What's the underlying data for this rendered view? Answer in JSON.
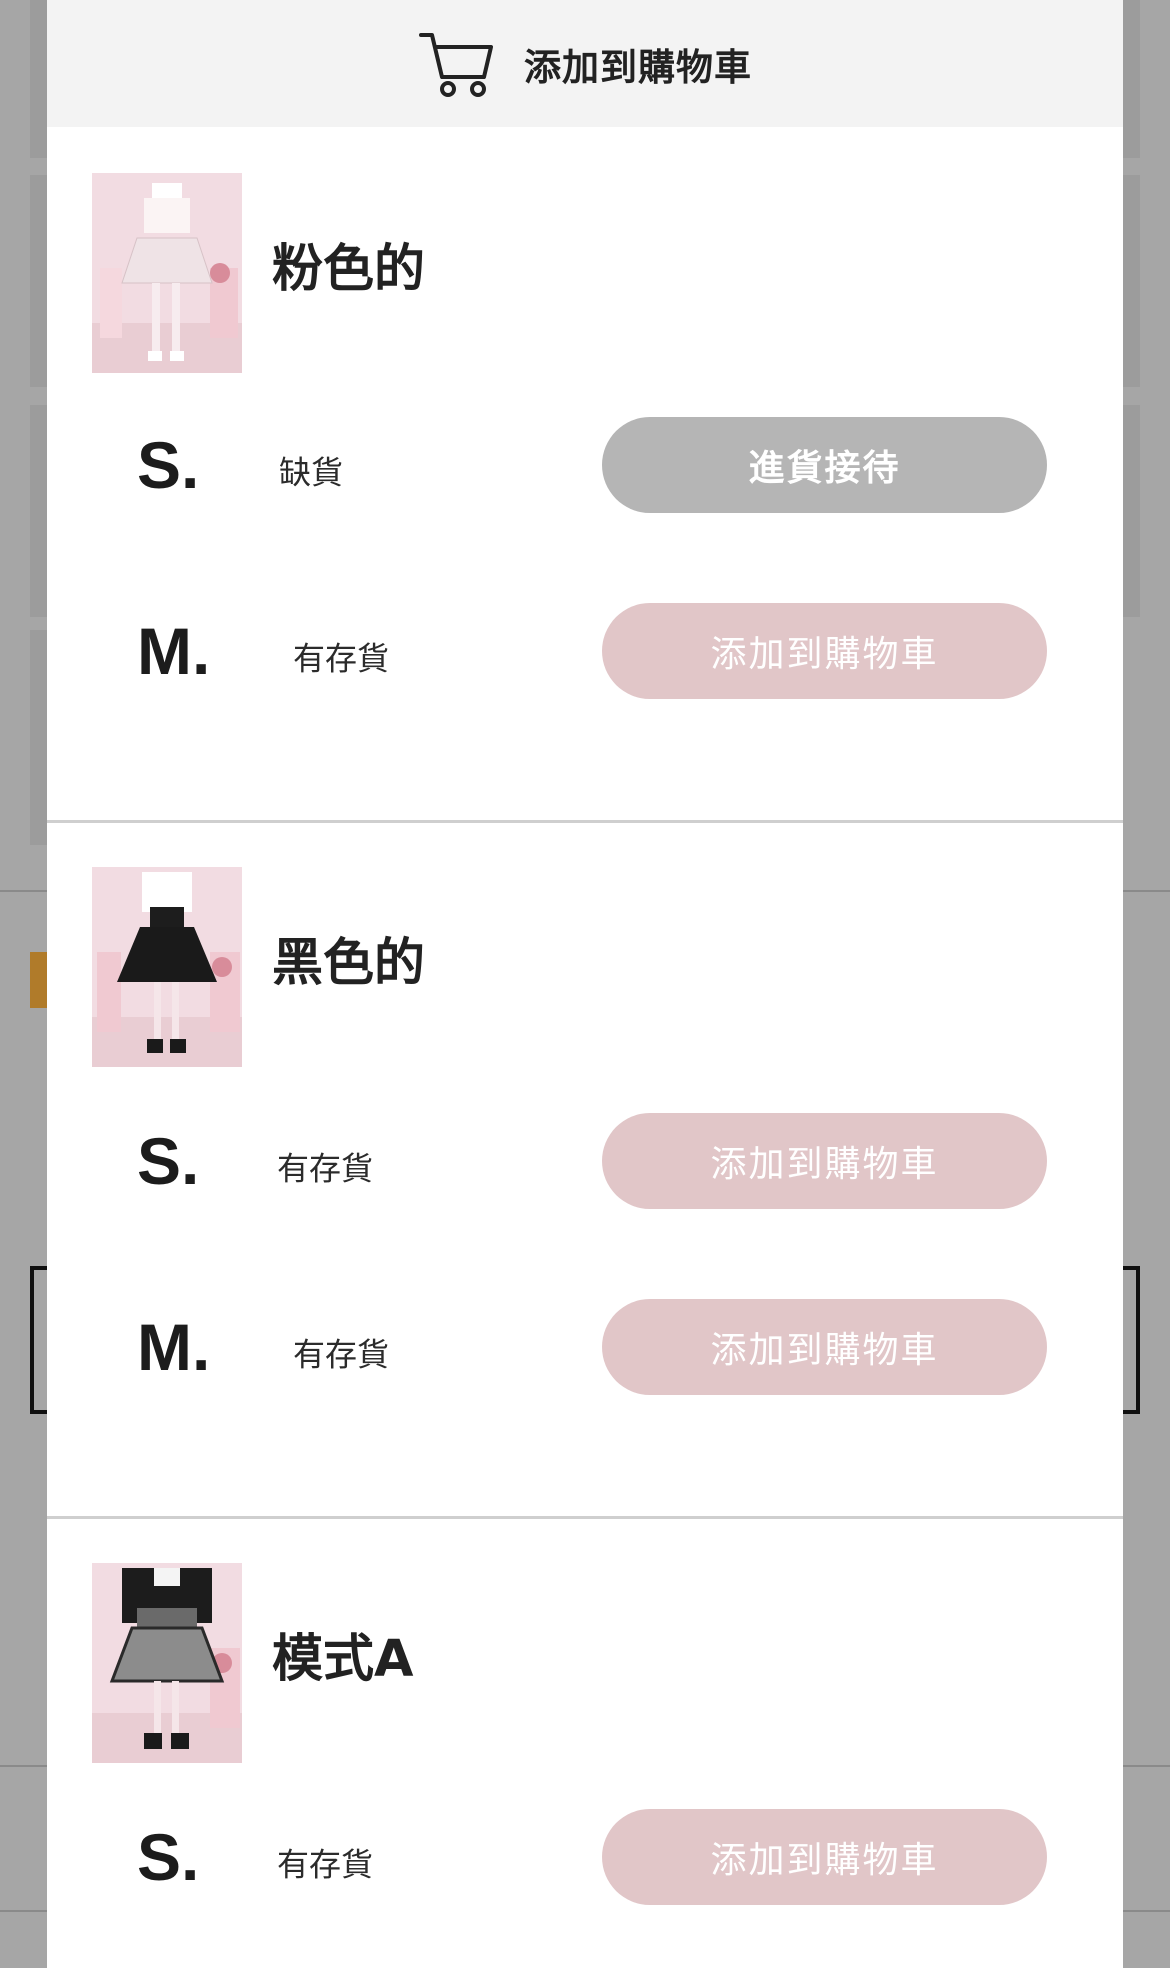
{
  "header": {
    "title": "添加到購物車",
    "icon": "cart-icon"
  },
  "colors": {
    "accent_button": "#e1c6c8",
    "disabled_button": "#b5b5b5",
    "header_bg": "#f3f3f3"
  },
  "variants": [
    {
      "color_name": "粉色的",
      "rows": [
        {
          "size": "S.",
          "stock": "缺貨",
          "button": "進貨接待"
        },
        {
          "size": "M.",
          "stock": "有存貨",
          "button": "添加到購物車"
        }
      ]
    },
    {
      "color_name": "黑色的",
      "rows": [
        {
          "size": "S.",
          "stock": "有存貨",
          "button": "添加到購物車"
        },
        {
          "size": "M.",
          "stock": "有存貨",
          "button": "添加到購物車"
        }
      ]
    },
    {
      "color_name": "模式A",
      "rows": [
        {
          "size": "S.",
          "stock": "有存貨",
          "button": "添加到購物車"
        }
      ]
    }
  ]
}
